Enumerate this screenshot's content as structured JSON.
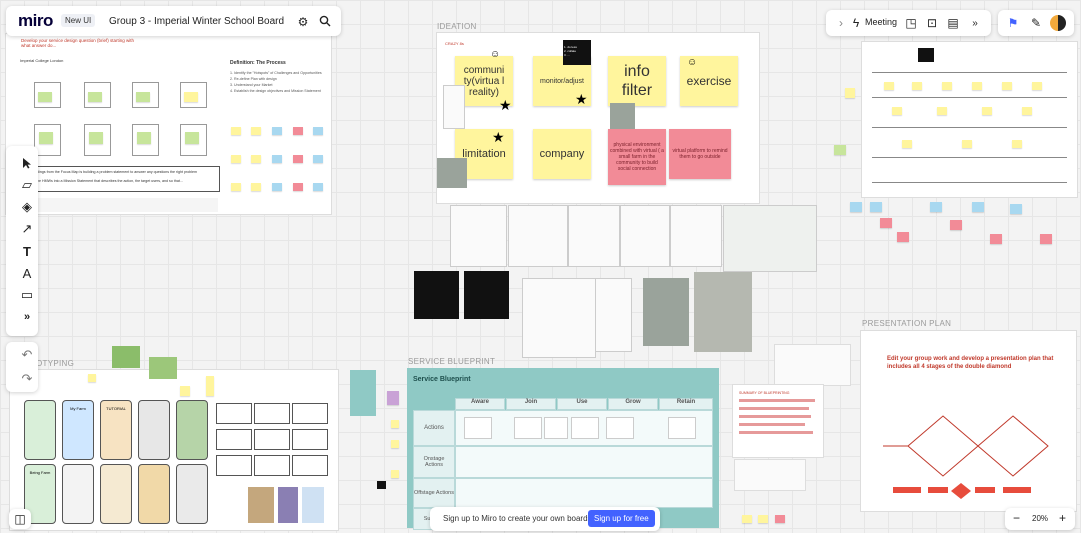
{
  "app": {
    "logo": "miro",
    "badge": "New UI",
    "board_title": "Group 3 - Imperial Winter School Board"
  },
  "right_toolbar": {
    "meeting_label": "Meeting"
  },
  "frames": {
    "ideation": "IDEATION",
    "prototyping": "OTYPING",
    "service_blueprint": "SERVICE BLUEPRINT",
    "presentation_plan": "PRESENTATION PLAN"
  },
  "left_frame": {
    "heading": "Develop your service design question (brief) starting with\nwhat answer do...",
    "definition_title": "Definition: The Process",
    "steps": [
      "1. Identify the \"Hotspots\" of Challenges and Opportunities",
      "2. Re-define Plan with design",
      "3. Understand your Market",
      "4. Establish the design objectives and Mission Statement"
    ],
    "bullet_1": "Findings from the Focus Map is building a problem statement to answer any questions the right problem",
    "bullet_2": "In the HMWs into a Mission Statement that describes the action, the target users, and so that..."
  },
  "ideation": {
    "stickies": {
      "community": "communi ty(virtua l reality)",
      "monitor": "monitor/adjust",
      "info": "info filter",
      "exercise": "exercise",
      "limitation": "limitation",
      "company": "company",
      "pink_1": "physical environment combined with virtual ( a small farm in the community to build social connection",
      "pink_2": "virtual platform to remind them to go outside",
      "black_note": "1. do less\n2. collate\n3. ..."
    },
    "crazy_label": "CRAZY 8s"
  },
  "service_blueprint": {
    "title": "Service Blueprint",
    "columns": [
      "Aware",
      "Join",
      "Use",
      "Grow",
      "Retain"
    ],
    "rows": [
      "Actions",
      "Onstage Actions",
      "Offstage Actions",
      "Sup Sys"
    ]
  },
  "presentation": {
    "heading": "Edit your group work and develop a presentation plan that includes all 4 stages of the double diamond"
  },
  "prototype_screens": [
    "My Farm",
    "TUTORIAL",
    "Being Farm"
  ],
  "signup_bar": {
    "text": "Sign up to Miro to create your own boards.",
    "button": "Sign up for free"
  },
  "zoom": {
    "value": "20%",
    "minus": "−",
    "plus": "+"
  },
  "colors": {
    "brand_blue": "#4262ff",
    "sticky_yellow": "#fff59d",
    "sticky_pink": "#f28b97",
    "teal": "#8fc9c5"
  }
}
